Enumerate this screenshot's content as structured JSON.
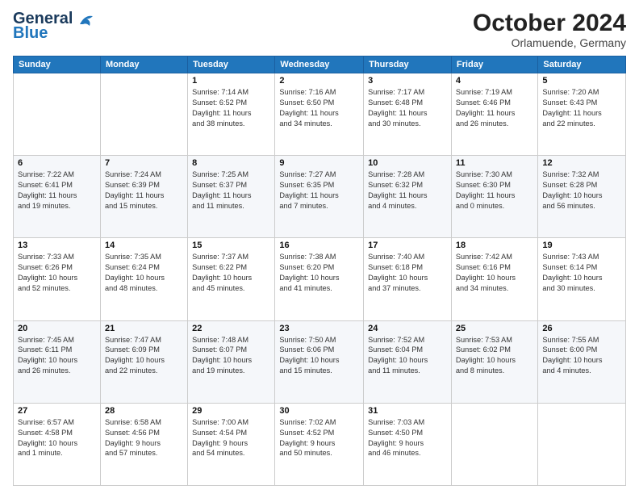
{
  "header": {
    "logo_line1": "General",
    "logo_line2": "Blue",
    "month": "October 2024",
    "location": "Orlamuende, Germany"
  },
  "weekdays": [
    "Sunday",
    "Monday",
    "Tuesday",
    "Wednesday",
    "Thursday",
    "Friday",
    "Saturday"
  ],
  "weeks": [
    [
      {
        "day": "",
        "info": ""
      },
      {
        "day": "",
        "info": ""
      },
      {
        "day": "1",
        "info": "Sunrise: 7:14 AM\nSunset: 6:52 PM\nDaylight: 11 hours\nand 38 minutes."
      },
      {
        "day": "2",
        "info": "Sunrise: 7:16 AM\nSunset: 6:50 PM\nDaylight: 11 hours\nand 34 minutes."
      },
      {
        "day": "3",
        "info": "Sunrise: 7:17 AM\nSunset: 6:48 PM\nDaylight: 11 hours\nand 30 minutes."
      },
      {
        "day": "4",
        "info": "Sunrise: 7:19 AM\nSunset: 6:46 PM\nDaylight: 11 hours\nand 26 minutes."
      },
      {
        "day": "5",
        "info": "Sunrise: 7:20 AM\nSunset: 6:43 PM\nDaylight: 11 hours\nand 22 minutes."
      }
    ],
    [
      {
        "day": "6",
        "info": "Sunrise: 7:22 AM\nSunset: 6:41 PM\nDaylight: 11 hours\nand 19 minutes."
      },
      {
        "day": "7",
        "info": "Sunrise: 7:24 AM\nSunset: 6:39 PM\nDaylight: 11 hours\nand 15 minutes."
      },
      {
        "day": "8",
        "info": "Sunrise: 7:25 AM\nSunset: 6:37 PM\nDaylight: 11 hours\nand 11 minutes."
      },
      {
        "day": "9",
        "info": "Sunrise: 7:27 AM\nSunset: 6:35 PM\nDaylight: 11 hours\nand 7 minutes."
      },
      {
        "day": "10",
        "info": "Sunrise: 7:28 AM\nSunset: 6:32 PM\nDaylight: 11 hours\nand 4 minutes."
      },
      {
        "day": "11",
        "info": "Sunrise: 7:30 AM\nSunset: 6:30 PM\nDaylight: 11 hours\nand 0 minutes."
      },
      {
        "day": "12",
        "info": "Sunrise: 7:32 AM\nSunset: 6:28 PM\nDaylight: 10 hours\nand 56 minutes."
      }
    ],
    [
      {
        "day": "13",
        "info": "Sunrise: 7:33 AM\nSunset: 6:26 PM\nDaylight: 10 hours\nand 52 minutes."
      },
      {
        "day": "14",
        "info": "Sunrise: 7:35 AM\nSunset: 6:24 PM\nDaylight: 10 hours\nand 48 minutes."
      },
      {
        "day": "15",
        "info": "Sunrise: 7:37 AM\nSunset: 6:22 PM\nDaylight: 10 hours\nand 45 minutes."
      },
      {
        "day": "16",
        "info": "Sunrise: 7:38 AM\nSunset: 6:20 PM\nDaylight: 10 hours\nand 41 minutes."
      },
      {
        "day": "17",
        "info": "Sunrise: 7:40 AM\nSunset: 6:18 PM\nDaylight: 10 hours\nand 37 minutes."
      },
      {
        "day": "18",
        "info": "Sunrise: 7:42 AM\nSunset: 6:16 PM\nDaylight: 10 hours\nand 34 minutes."
      },
      {
        "day": "19",
        "info": "Sunrise: 7:43 AM\nSunset: 6:14 PM\nDaylight: 10 hours\nand 30 minutes."
      }
    ],
    [
      {
        "day": "20",
        "info": "Sunrise: 7:45 AM\nSunset: 6:11 PM\nDaylight: 10 hours\nand 26 minutes."
      },
      {
        "day": "21",
        "info": "Sunrise: 7:47 AM\nSunset: 6:09 PM\nDaylight: 10 hours\nand 22 minutes."
      },
      {
        "day": "22",
        "info": "Sunrise: 7:48 AM\nSunset: 6:07 PM\nDaylight: 10 hours\nand 19 minutes."
      },
      {
        "day": "23",
        "info": "Sunrise: 7:50 AM\nSunset: 6:06 PM\nDaylight: 10 hours\nand 15 minutes."
      },
      {
        "day": "24",
        "info": "Sunrise: 7:52 AM\nSunset: 6:04 PM\nDaylight: 10 hours\nand 11 minutes."
      },
      {
        "day": "25",
        "info": "Sunrise: 7:53 AM\nSunset: 6:02 PM\nDaylight: 10 hours\nand 8 minutes."
      },
      {
        "day": "26",
        "info": "Sunrise: 7:55 AM\nSunset: 6:00 PM\nDaylight: 10 hours\nand 4 minutes."
      }
    ],
    [
      {
        "day": "27",
        "info": "Sunrise: 6:57 AM\nSunset: 4:58 PM\nDaylight: 10 hours\nand 1 minute."
      },
      {
        "day": "28",
        "info": "Sunrise: 6:58 AM\nSunset: 4:56 PM\nDaylight: 9 hours\nand 57 minutes."
      },
      {
        "day": "29",
        "info": "Sunrise: 7:00 AM\nSunset: 4:54 PM\nDaylight: 9 hours\nand 54 minutes."
      },
      {
        "day": "30",
        "info": "Sunrise: 7:02 AM\nSunset: 4:52 PM\nDaylight: 9 hours\nand 50 minutes."
      },
      {
        "day": "31",
        "info": "Sunrise: 7:03 AM\nSunset: 4:50 PM\nDaylight: 9 hours\nand 46 minutes."
      },
      {
        "day": "",
        "info": ""
      },
      {
        "day": "",
        "info": ""
      }
    ]
  ]
}
